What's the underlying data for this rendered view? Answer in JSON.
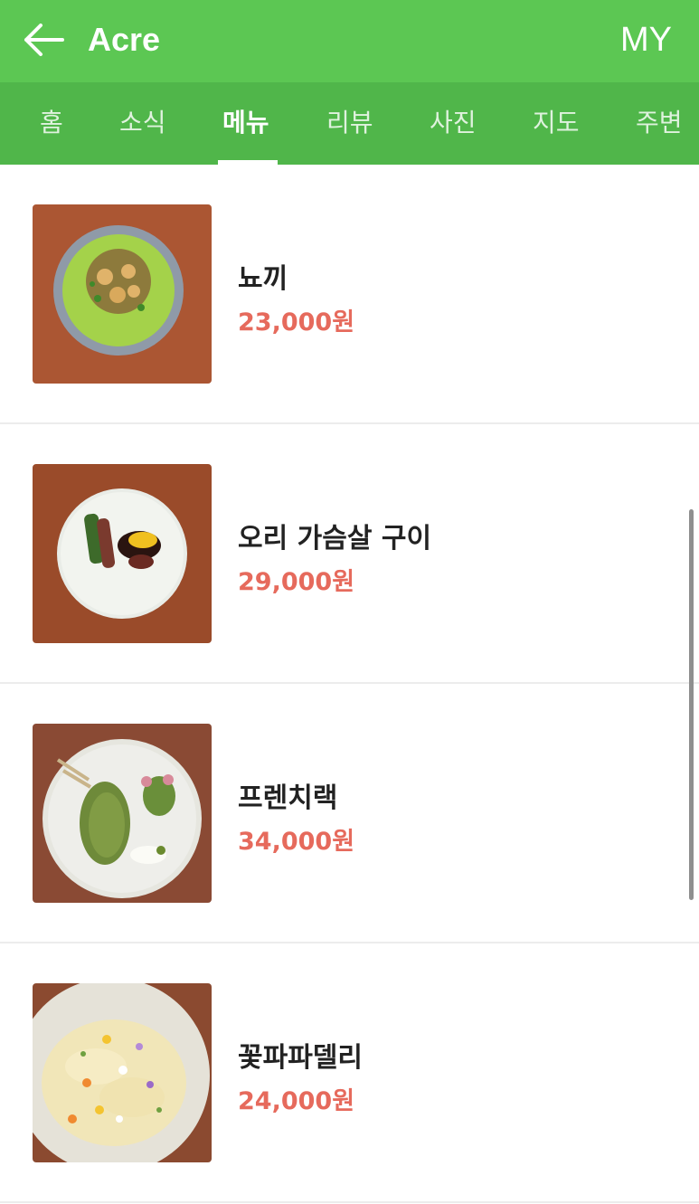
{
  "header": {
    "back_icon": "arrow-left-icon",
    "title": "Acre",
    "my_label": "MY",
    "background": "#5cc753"
  },
  "tabs": [
    {
      "label": "홈",
      "active": false
    },
    {
      "label": "소식",
      "active": false
    },
    {
      "label": "메뉴",
      "active": true
    },
    {
      "label": "리뷰",
      "active": false
    },
    {
      "label": "사진",
      "active": false
    },
    {
      "label": "지도",
      "active": false
    },
    {
      "label": "주변",
      "active": false
    }
  ],
  "menu": {
    "items": [
      {
        "name": "뇨끼",
        "price": "23,000원"
      },
      {
        "name": "오리 가슴살 구이",
        "price": "29,000원"
      },
      {
        "name": "프렌치랙",
        "price": "34,000원"
      },
      {
        "name": "꽃파파델리",
        "price": "24,000원"
      }
    ],
    "price_color": "#e66a5c"
  }
}
